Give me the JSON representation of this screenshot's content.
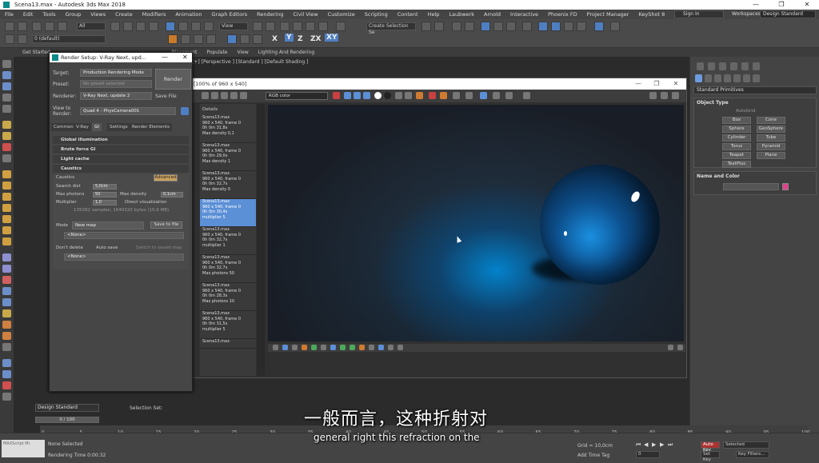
{
  "titlebar": {
    "title": "Scena13.max - Autodesk 3ds Max 2018",
    "minimize": "—",
    "maximize": "❐",
    "close": "✕"
  },
  "menubar": {
    "items": [
      "File",
      "Edit",
      "Tools",
      "Group",
      "Views",
      "Create",
      "Modifiers",
      "Animation",
      "Graph Editors",
      "Rendering",
      "Civil View",
      "Customize",
      "Scripting",
      "Content",
      "Help",
      "Laubwerk",
      "Arnold",
      "Interactive",
      "Phoenix FD",
      "Project Manager",
      "KeyShot 8"
    ],
    "signin": "Sign In",
    "workspaces_label": "Workspaces:",
    "workspaces_value": "Design Standard"
  },
  "toolbar": {
    "filter": "All",
    "view": "View",
    "layer": "0 (default)",
    "selection_set": "Create Selection Se",
    "axes": [
      "X",
      "Y",
      "Z",
      "ZX",
      "XY"
    ]
  },
  "ribbon": {
    "items": [
      "Get Started",
      "Placement",
      "Populate",
      "View",
      "Lighting And Rendering"
    ]
  },
  "viewport": {
    "label": "[+] [Perspective ] [Standard ] [Default Shading ]"
  },
  "command_panel": {
    "dropdown": "Standard Primitives",
    "object_type": "Object Type",
    "autogrid": "AutoGrid",
    "buttons": [
      "Box",
      "Cone",
      "Sphere",
      "GeoSphere",
      "Cylinder",
      "Tube",
      "Torus",
      "Pyramid",
      "Teapot",
      "Plane",
      "TextPlus"
    ],
    "name_and_color": "Name and Color",
    "object_color": "#e0418a"
  },
  "render_setup": {
    "title": "Render Setup: V-Ray Next, upd...",
    "target_label": "Target:",
    "target_value": "Production Rendering Mode",
    "preset_label": "Preset:",
    "preset_value": "No preset selected",
    "renderer_label": "Renderer:",
    "renderer_value": "V-Ray Next, update 2",
    "save_file": "Save File",
    "view_label": "View to Render:",
    "view_value": "Quad 4 - PhysCamera001",
    "render_button": "Render",
    "tabs": [
      "Common",
      "V-Ray",
      "GI",
      "Settings",
      "Render Elements"
    ],
    "sections": [
      "Global illumination",
      "Brute force GI",
      "Light cache",
      "Caustics"
    ],
    "caustics_check": "Caustics",
    "advanced": "Advanced",
    "search_dist_label": "Search dist",
    "search_dist_value": "5,0cm",
    "max_photons_label": "Max photons",
    "max_photons_value": "50",
    "max_density_label": "Max density",
    "max_density_value": "0,1cm",
    "multiplier_label": "Multiplier",
    "multiplier_value": "1,0",
    "direct_vis": "Direct visualization",
    "samples_info": "135092 samples; 1640320 bytes (15,9 MB)",
    "mode_label": "Mode",
    "mode_value": "New map",
    "save_to_file": "Save to file",
    "none1": "<None>",
    "dont_delete": "Don't delete",
    "auto_save": "Auto save",
    "switch_saved": "Switch to saved map",
    "none2": "<None>"
  },
  "frame_buffer": {
    "title": "ffer - [100% of 960 x 540]",
    "channel": "RGB color",
    "history_header": "Details",
    "history": [
      {
        "name": "Scena13.max",
        "res": "960 x 540, frame 0",
        "time": "0h 0m 31,8s",
        "note": "Max density 0,1"
      },
      {
        "name": "Scena13.max",
        "res": "960 x 540, frame 0",
        "time": "0h 0m 29,0s",
        "note": "Max density 1"
      },
      {
        "name": "Scena13.max",
        "res": "960 x 540, frame 0",
        "time": "0h 0m 32,7s",
        "note": "Max density 0"
      },
      {
        "name": "Scena13.max",
        "res": "960 x 540, frame 0",
        "time": "0h 0m 30,4s",
        "note": "multiplier 5"
      },
      {
        "name": "Scena13.max",
        "res": "960 x 540, frame 0",
        "time": "0h 0m 32,7s",
        "note": "multiplier 1"
      },
      {
        "name": "Scena13.max",
        "res": "960 x 540, frame 0",
        "time": "0h 0m 32,7s",
        "note": "Max photons 50"
      },
      {
        "name": "Scena13.max",
        "res": "960 x 540, frame 0",
        "time": "0h 0m 28,3s",
        "note": "Max photons 10"
      },
      {
        "name": "Scena13.max",
        "res": "960 x 540, frame 0",
        "time": "0h 0m 31,5s",
        "note": "multiplier 5"
      },
      {
        "name": "Scena13.max",
        "res": "",
        "time": "",
        "note": ""
      }
    ],
    "selected_index": 3
  },
  "bottom": {
    "workspace": "Design Standard",
    "selection_set": "Selection Set:",
    "time_slider": "0 / 100",
    "ticks": [
      "0",
      "5",
      "10",
      "15",
      "20",
      "25",
      "30",
      "35",
      "40",
      "45",
      "50",
      "55",
      "60",
      "65",
      "70",
      "75",
      "80",
      "85",
      "90",
      "95",
      "100"
    ],
    "status1": "None Selected",
    "status2": "Rendering Time 0:00:32",
    "grid": "Grid = 10,0cm",
    "add_time_tag": "Add Time Tag",
    "auto_key": "Auto Key",
    "selected": "Selected",
    "set_key": "Set Key",
    "key_filters": "Key Filters...",
    "frame": "0",
    "maxscript": "MAXScript Mi"
  },
  "subtitle": {
    "chinese": "一般而言，这种折射对",
    "english": "general right this refraction on the"
  }
}
